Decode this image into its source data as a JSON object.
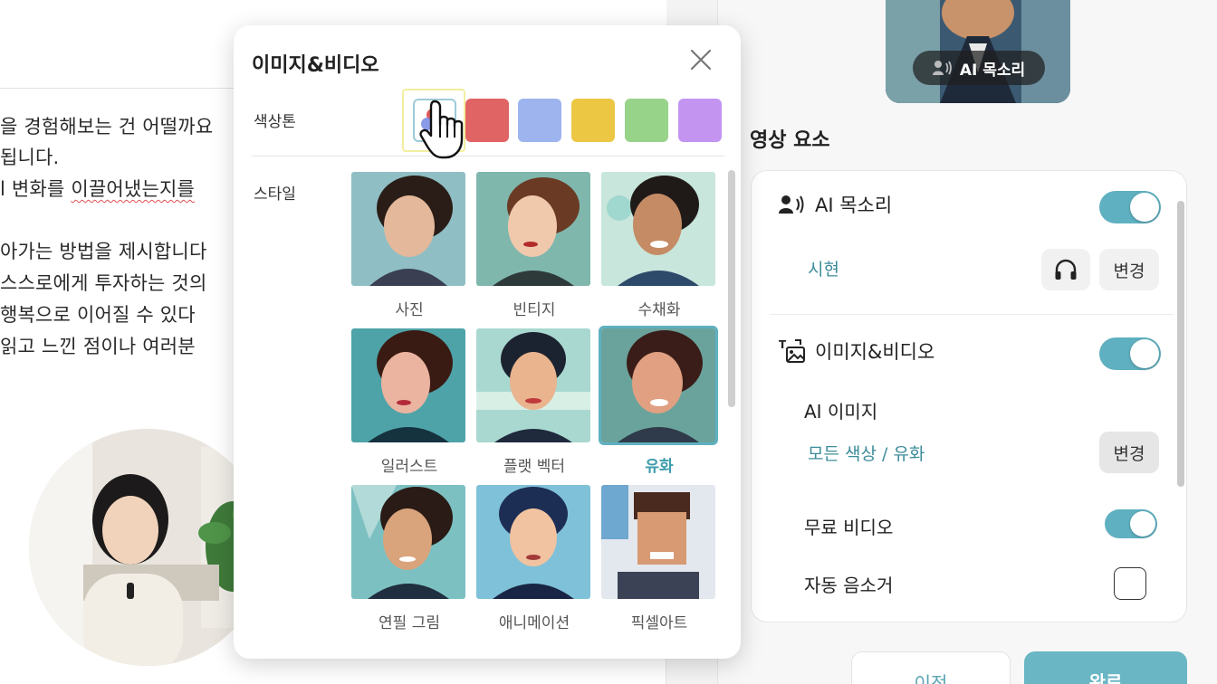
{
  "document": {
    "lines": [
      {
        "text": "을 경험해보는 건 어떨까요",
        "squiggle": ""
      },
      {
        "text": "됩니다.",
        "squiggle": ""
      },
      {
        "pre": "l 변화를 ",
        "squiggle": "이끌어냈는지를",
        "post": ""
      },
      {
        "text": "아가는 방법을 제시합니다",
        "squiggle": ""
      },
      {
        "text": "스스로에게 투자하는 것의",
        "squiggle": ""
      },
      {
        "text": " 행복으로 이어질 수 있다",
        "squiggle": ""
      },
      {
        "text": "읽고 느낀 점이나 여러분",
        "squiggle": ""
      }
    ]
  },
  "preview": {
    "voice_pill": "AI 목소리"
  },
  "video_elements": {
    "title": "영상 요소",
    "ai_voice": {
      "label": "AI 목소리",
      "voice_name": "시현",
      "change_label": "변경",
      "enabled": true
    },
    "image_video": {
      "label": "이미지&비디오",
      "enabled": true,
      "ai_image_label": "AI 이미지",
      "ai_image_value": "모든 색상 / 유화",
      "change_label": "변경",
      "free_video_label": "무료 비디오",
      "free_video_enabled": true,
      "auto_mute_label": "자동 음소거",
      "auto_mute_checked": false
    },
    "prev_button": "이전",
    "done_button": "완료"
  },
  "modal": {
    "title": "이미지&비디오",
    "tone_label": "색상톤",
    "style_label": "스타일",
    "swatches": [
      {
        "name": "all-colors",
        "color": "#ffffff"
      },
      {
        "name": "red",
        "color": "#e06464"
      },
      {
        "name": "blue",
        "color": "#9db4ee"
      },
      {
        "name": "yellow",
        "color": "#ecc744"
      },
      {
        "name": "green",
        "color": "#98d38a"
      },
      {
        "name": "purple",
        "color": "#c395f1"
      }
    ],
    "styles": [
      {
        "label": "사진",
        "selected": false
      },
      {
        "label": "빈티지",
        "selected": false
      },
      {
        "label": "수채화",
        "selected": false
      },
      {
        "label": "일러스트",
        "selected": false
      },
      {
        "label": "플랫 벡터",
        "selected": false
      },
      {
        "label": "유화",
        "selected": true
      },
      {
        "label": "연필 그림",
        "selected": false
      },
      {
        "label": "애니메이션",
        "selected": false
      },
      {
        "label": "픽셀아트",
        "selected": false
      }
    ]
  },
  "colors": {
    "accent": "#5fb0c0",
    "accent_text": "#3c9cab"
  }
}
